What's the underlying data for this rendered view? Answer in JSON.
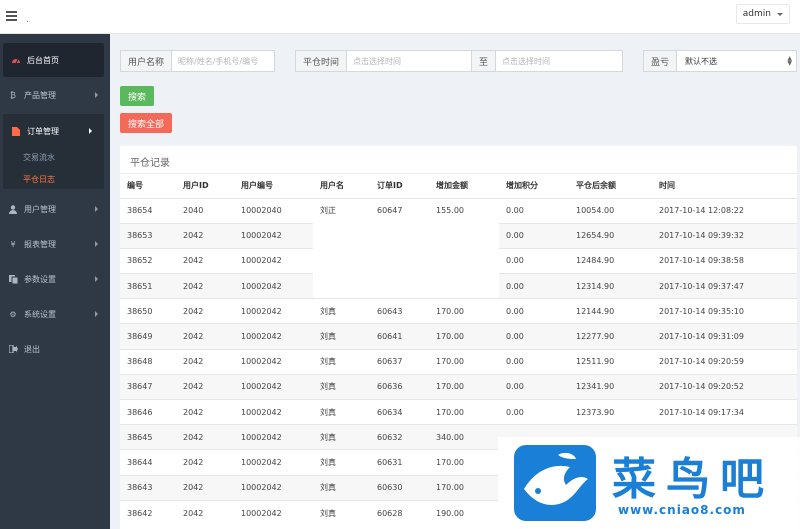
{
  "topbar": {
    "brand": ".",
    "user": "admin"
  },
  "sidebar": {
    "home": "后台首页",
    "items": [
      {
        "label": "产品管理",
        "icon": "bitcoin-icon"
      },
      {
        "label": "订单管理",
        "icon": "file-icon"
      },
      {
        "label": "用户管理",
        "icon": "user-icon"
      },
      {
        "label": "报表管理",
        "icon": "yen-icon"
      },
      {
        "label": "参数设置",
        "icon": "copy-icon"
      },
      {
        "label": "系统设置",
        "icon": "gears-icon"
      },
      {
        "label": "退出",
        "icon": "signout-icon"
      }
    ],
    "sub": [
      "交易流水",
      "平仓日志"
    ]
  },
  "filters": {
    "username_label": "用户名称",
    "username_placeholder": "昵称/姓名/手机号/编号",
    "time_label": "平仓时间",
    "time_from_placeholder": "点击选择时间",
    "to": "至",
    "time_to_placeholder": "点击选择时间",
    "pl_label": "盈亏",
    "pl_value": "默认不选"
  },
  "buttons": {
    "search": "搜索",
    "search_all": "搜索全部"
  },
  "panel": {
    "title": "平仓记录",
    "columns": [
      "编号",
      "用户ID",
      "用户编号",
      "用户名",
      "订单ID",
      "增加金额",
      "增加积分",
      "平仓后余额",
      "时间"
    ],
    "rows": [
      [
        "38654",
        "2040",
        "10002040",
        "刘正",
        "60647",
        "155.00",
        "0.00",
        "10054.00",
        "2017-10-14 12:08:22"
      ],
      [
        "38653",
        "2042",
        "10002042",
        "",
        "",
        "",
        "0.00",
        "12654.90",
        "2017-10-14 09:39:32"
      ],
      [
        "38652",
        "2042",
        "10002042",
        "",
        "",
        "",
        "0.00",
        "12484.90",
        "2017-10-14 09:38:58"
      ],
      [
        "38651",
        "2042",
        "10002042",
        "",
        "",
        "",
        "0.00",
        "12314.90",
        "2017-10-14 09:37:47"
      ],
      [
        "38650",
        "2042",
        "10002042",
        "刘真",
        "60643",
        "170.00",
        "0.00",
        "12144.90",
        "2017-10-14 09:35:10"
      ],
      [
        "38649",
        "2042",
        "10002042",
        "刘真",
        "60641",
        "170.00",
        "0.00",
        "12277.90",
        "2017-10-14 09:31:09"
      ],
      [
        "38648",
        "2042",
        "10002042",
        "刘真",
        "60637",
        "170.00",
        "0.00",
        "12511.90",
        "2017-10-14 09:20:59"
      ],
      [
        "38647",
        "2042",
        "10002042",
        "刘真",
        "60636",
        "170.00",
        "0.00",
        "12341.90",
        "2017-10-14 09:20:52"
      ],
      [
        "38646",
        "2042",
        "10002042",
        "刘真",
        "60634",
        "170.00",
        "0.00",
        "12373.90",
        "2017-10-14 09:17:34"
      ],
      [
        "38645",
        "2042",
        "10002042",
        "刘真",
        "60632",
        "340.00",
        "",
        "",
        ""
      ],
      [
        "38644",
        "2042",
        "10002042",
        "刘真",
        "60631",
        "170.00",
        "",
        "",
        ""
      ],
      [
        "38643",
        "2042",
        "10002042",
        "刘真",
        "60630",
        "170.00",
        "",
        "",
        ""
      ],
      [
        "38642",
        "2042",
        "10002042",
        "刘真",
        "60628",
        "190.00",
        "",
        "",
        ""
      ]
    ]
  },
  "watermark": {
    "cn": "菜鸟吧",
    "url": "www.cniao8.com"
  },
  "colors": {
    "sidebar": "#2f3945",
    "accent": "#ff7a45",
    "search": "#5cb85c",
    "search_all": "#f36a5a",
    "watermark": "#1a7fd6"
  }
}
